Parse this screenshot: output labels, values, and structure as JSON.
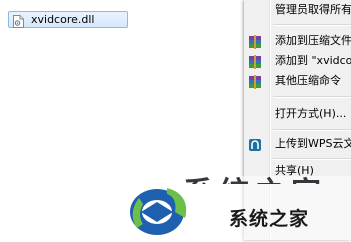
{
  "file": {
    "name": "xvidcore.dll",
    "icon": "dll-file-icon"
  },
  "context_menu": {
    "items": [
      {
        "label": "管理员取得所有",
        "icon": ""
      },
      {
        "label": "添加到压缩文件",
        "icon": "winrar-archive-icon"
      },
      {
        "label": "添加到 \"xvidcore.rar\"",
        "icon": "winrar-archive-icon"
      },
      {
        "label": "其他压缩命令",
        "icon": "winrar-archive-icon"
      },
      {
        "label": "打开方式(H)...",
        "icon": ""
      },
      {
        "label": "上传到WPS云文档",
        "icon": "wps-cloud-icon"
      },
      {
        "label": "共享(H)",
        "icon": ""
      }
    ]
  },
  "watermark": {
    "ghost_text": "系统之家",
    "text": "系统之家",
    "colors": {
      "blue": "#1e5fb0",
      "green": "#6cc04a",
      "dark": "#1a1a1a"
    }
  }
}
